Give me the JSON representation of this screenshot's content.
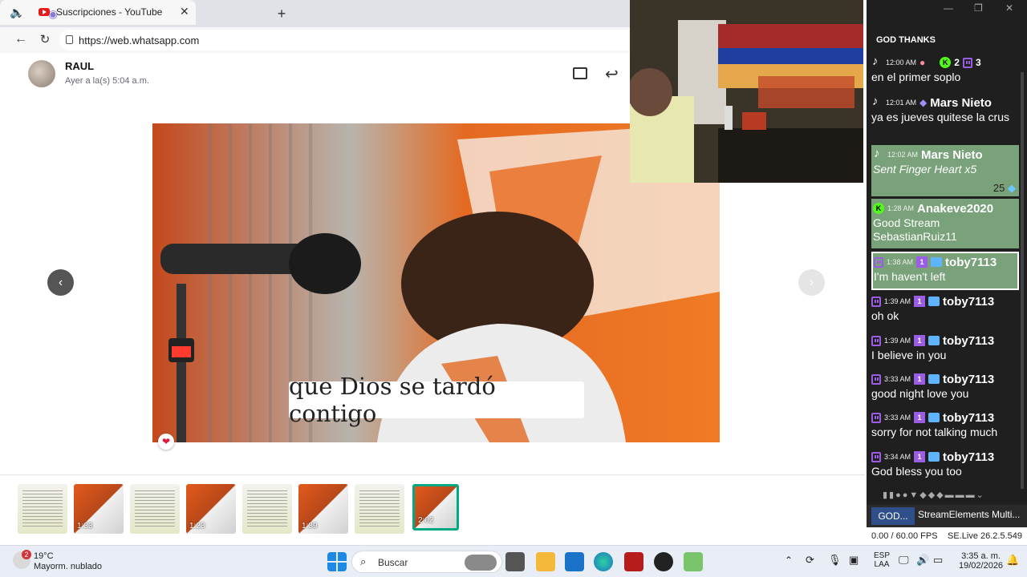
{
  "browser": {
    "tab_title": "Suscripciones - YouTube",
    "url": "https://web.whatsapp.com"
  },
  "whatsapp": {
    "sender_name": "RAUL",
    "sender_time": "Ayer a la(s) 5:04 a.m.",
    "subtitle": "que Dios se tardó contigo",
    "thumbs": [
      {
        "type": "doc",
        "duration": ""
      },
      {
        "type": "video",
        "duration": "1:33"
      },
      {
        "type": "doc",
        "duration": ""
      },
      {
        "type": "video",
        "duration": "1:23"
      },
      {
        "type": "doc",
        "duration": ""
      },
      {
        "type": "video",
        "duration": "1:39"
      },
      {
        "type": "doc",
        "duration": ""
      },
      {
        "type": "video",
        "duration": "2:02"
      }
    ]
  },
  "chat": {
    "title": "GOD THANKS",
    "top_counts": {
      "kick": "2",
      "twitch": "3"
    },
    "messages": [
      {
        "platform": "tiktok",
        "time": "12:00 AM",
        "user": "",
        "text": "en el primer soplo"
      },
      {
        "platform": "tiktok",
        "time": "12:01 AM",
        "user": "Mars Nieto",
        "text": "ya es jueves quitese la crus"
      },
      {
        "platform": "tiktok",
        "time": "12:02 AM",
        "user": "Mars Nieto",
        "text": "Sent Finger Heart x5",
        "extra": "25"
      },
      {
        "platform": "kick",
        "time": "1:28 AM",
        "user": "Anakeve2020",
        "text": "Good Stream SebastianRuiz11"
      },
      {
        "platform": "twitch",
        "time": "1:38 AM",
        "user": "toby7113",
        "text": "I'm haven't left"
      },
      {
        "platform": "twitch",
        "time": "1:39 AM",
        "user": "toby7113",
        "text": "oh ok"
      },
      {
        "platform": "twitch",
        "time": "1:39 AM",
        "user": "toby7113",
        "text": "I believe in you"
      },
      {
        "platform": "twitch",
        "time": "3:33 AM",
        "user": "toby7113",
        "text": "good night love you"
      },
      {
        "platform": "twitch",
        "time": "3:33 AM",
        "user": "toby7113",
        "text": "sorry for not talking much"
      },
      {
        "platform": "twitch",
        "time": "3:34 AM",
        "user": "toby7113",
        "text": "God bless you too"
      }
    ],
    "tab1": "GOD...",
    "tab2": "StreamElements Multi...",
    "fps": "0.00 / 60.00 FPS",
    "version": "SE.Live 26.2.5.549"
  },
  "taskbar": {
    "weather_temp": "19°C",
    "weather_desc": "Mayorm. nublado",
    "weather_badge": "2",
    "search_label": "Buscar",
    "lang1": "ESP",
    "lang2": "LAA",
    "time": "3:35 a. m.",
    "date": "19/02/2026"
  }
}
